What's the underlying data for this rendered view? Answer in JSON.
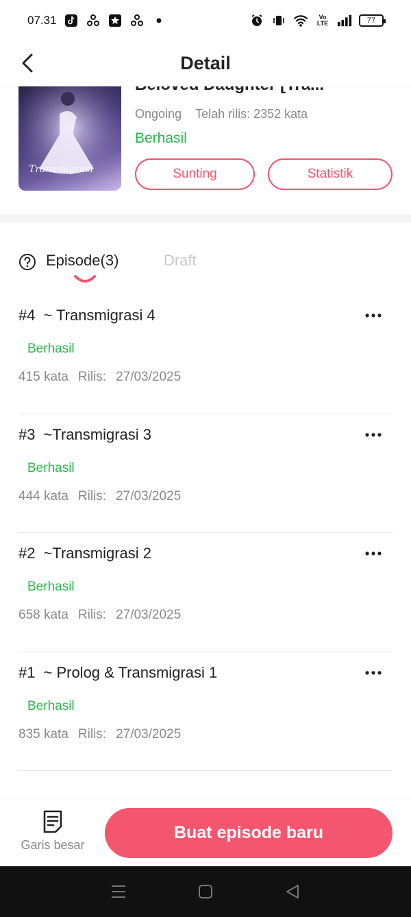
{
  "status_bar": {
    "time": "07.31",
    "battery": "77",
    "network": "LTE"
  },
  "header": {
    "title": "Detail"
  },
  "book": {
    "title": "Beloved Daughter [Tra...",
    "state": "Ongoing",
    "released_label": "Telah rilis: 2352 kata",
    "status": "Berhasil",
    "edit_label": "Sunting",
    "stats_label": "Statistik",
    "cover_text": "Transmigrasi"
  },
  "tabs": {
    "episode_label": "Episode(3)",
    "draft_label": "Draft"
  },
  "episodes": [
    {
      "number": "#4",
      "title": "~ Transmigrasi 4",
      "status": "Berhasil",
      "words": "415 kata",
      "release_label": "Rilis:",
      "date": "27/03/2025"
    },
    {
      "number": "#3",
      "title": "~Transmigrasi 3",
      "status": "Berhasil",
      "words": "444 kata",
      "release_label": "Rilis:",
      "date": "27/03/2025"
    },
    {
      "number": "#2",
      "title": "~Transmigrasi 2",
      "status": "Berhasil",
      "words": "658 kata",
      "release_label": "Rilis:",
      "date": "27/03/2025"
    },
    {
      "number": "#1",
      "title": "~ Prolog & Transmigrasi 1",
      "status": "Berhasil",
      "words": "835 kata",
      "release_label": "Rilis:",
      "date": "27/03/2025"
    }
  ],
  "bottom_bar": {
    "outline_label": "Garis besar",
    "create_label": "Buat episode baru"
  },
  "colors": {
    "accent": "#f4566f",
    "success": "#2bb74a",
    "muted": "#8a8a8a"
  },
  "icons": {
    "back": "chevron-left-icon",
    "help": "question-circle-icon",
    "more": "more-horizontal-icon",
    "outline": "document-list-icon",
    "nav_menu": "menu-icon",
    "nav_home": "square-icon",
    "nav_back": "triangle-back-icon"
  }
}
